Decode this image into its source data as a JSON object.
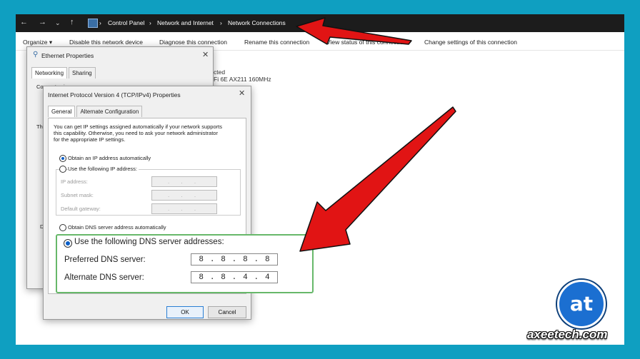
{
  "explorer": {
    "breadcrumb": [
      "Control Panel",
      "Network and Internet",
      "Network Connections"
    ],
    "commands": [
      "Organize ▾",
      "Disable this network device",
      "Diagnose this connection",
      "Rename this connection",
      "View status of this connection",
      "Change settings of this connection"
    ],
    "background_text": [
      "cted",
      "Fi 6E AX211 160MHz"
    ]
  },
  "ethernet_dialog": {
    "title": "Ethernet Properties",
    "tabs": [
      "Networking",
      "Sharing"
    ],
    "connect_label": "Connect using:",
    "th_label": "Th",
    "d_label": "D"
  },
  "ipv4_dialog": {
    "title": "Internet Protocol Version 4 (TCP/IPv4) Properties",
    "tabs": [
      "General",
      "Alternate Configuration"
    ],
    "description": [
      "You can get IP settings assigned automatically if your network supports",
      "this capability. Otherwise, you need to ask your network administrator",
      "for the appropriate IP settings."
    ],
    "obtain_ip_auto": "Obtain an IP address automatically",
    "use_following_ip": "Use the following IP address:",
    "ip_address_label": "IP address:",
    "subnet_mask_label": "Subnet mask:",
    "default_gateway_label": "Default gateway:",
    "empty_ip": ". . .",
    "obtain_dns_auto": "Obtain DNS server address automatically",
    "use_following_dns": "Use the following DNS server addresses:",
    "preferred_dns_label": "Preferred DNS server:",
    "alternate_dns_label": "Alternate DNS server:",
    "preferred_dns": [
      "8",
      "8",
      "8",
      "8"
    ],
    "alternate_dns": [
      "8",
      "8",
      "4",
      "4"
    ],
    "ok_label": "OK",
    "cancel_label": "Cancel"
  },
  "brand": {
    "logo_glyph": "at",
    "site": "axeetech.com"
  },
  "colors": {
    "background": "#0f9fc1",
    "highlight_border": "#67b86a",
    "arrow": "#e11414",
    "logo": "#1b6fd1"
  }
}
